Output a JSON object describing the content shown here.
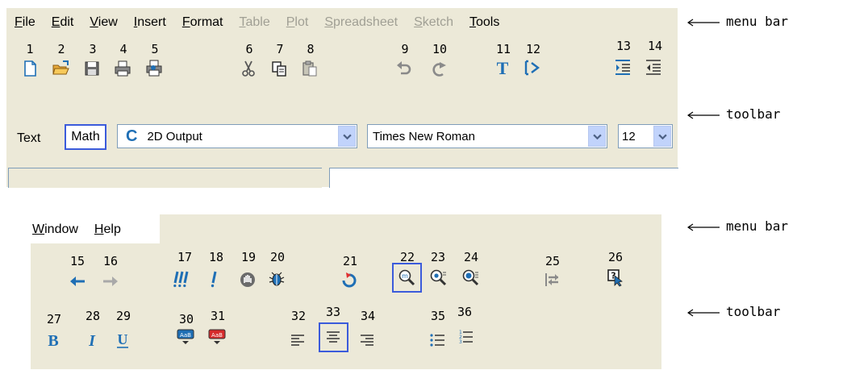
{
  "top_menu": {
    "items": [
      {
        "first": "F",
        "rest": "ile",
        "disabled": false
      },
      {
        "first": "E",
        "rest": "dit",
        "disabled": false
      },
      {
        "first": "V",
        "rest": "iew",
        "disabled": false
      },
      {
        "first": "I",
        "rest": "nsert",
        "disabled": false
      },
      {
        "first": "F",
        "rest": "ormat",
        "disabled": false
      },
      {
        "first": "T",
        "rest": "able",
        "disabled": true
      },
      {
        "first": "P",
        "rest": "lot",
        "disabled": true
      },
      {
        "first": "S",
        "rest": "preadsheet",
        "disabled": true
      },
      {
        "first": "S",
        "rest": "ketch",
        "disabled": true
      },
      {
        "first": "T",
        "rest": "ools",
        "disabled": false
      }
    ]
  },
  "bottom_menu": {
    "items": [
      {
        "first": "W",
        "rest": "indow",
        "disabled": false
      },
      {
        "first": "H",
        "rest": "elp",
        "disabled": false
      }
    ]
  },
  "annotations": {
    "menu_bar": "menu bar",
    "toolbar": "toolbar"
  },
  "numbers": [
    "1",
    "2",
    "3",
    "4",
    "5",
    "6",
    "7",
    "8",
    "9",
    "10",
    "11",
    "12",
    "13",
    "14",
    "15",
    "16",
    "17",
    "18",
    "19",
    "20",
    "21",
    "22",
    "23",
    "24",
    "25",
    "26",
    "27",
    "28",
    "29",
    "30",
    "31",
    "32",
    "33",
    "34",
    "35",
    "36"
  ],
  "format_bar": {
    "text_label": "Text",
    "math_label": "Math",
    "output_icon": "C",
    "output_value": "2D Output",
    "font_value": "Times New Roman",
    "size_value": "12"
  },
  "colors": {
    "panel": "#ece9d8",
    "accent_blue": "#1f6fb5",
    "highlight": "#3b5bdb"
  }
}
